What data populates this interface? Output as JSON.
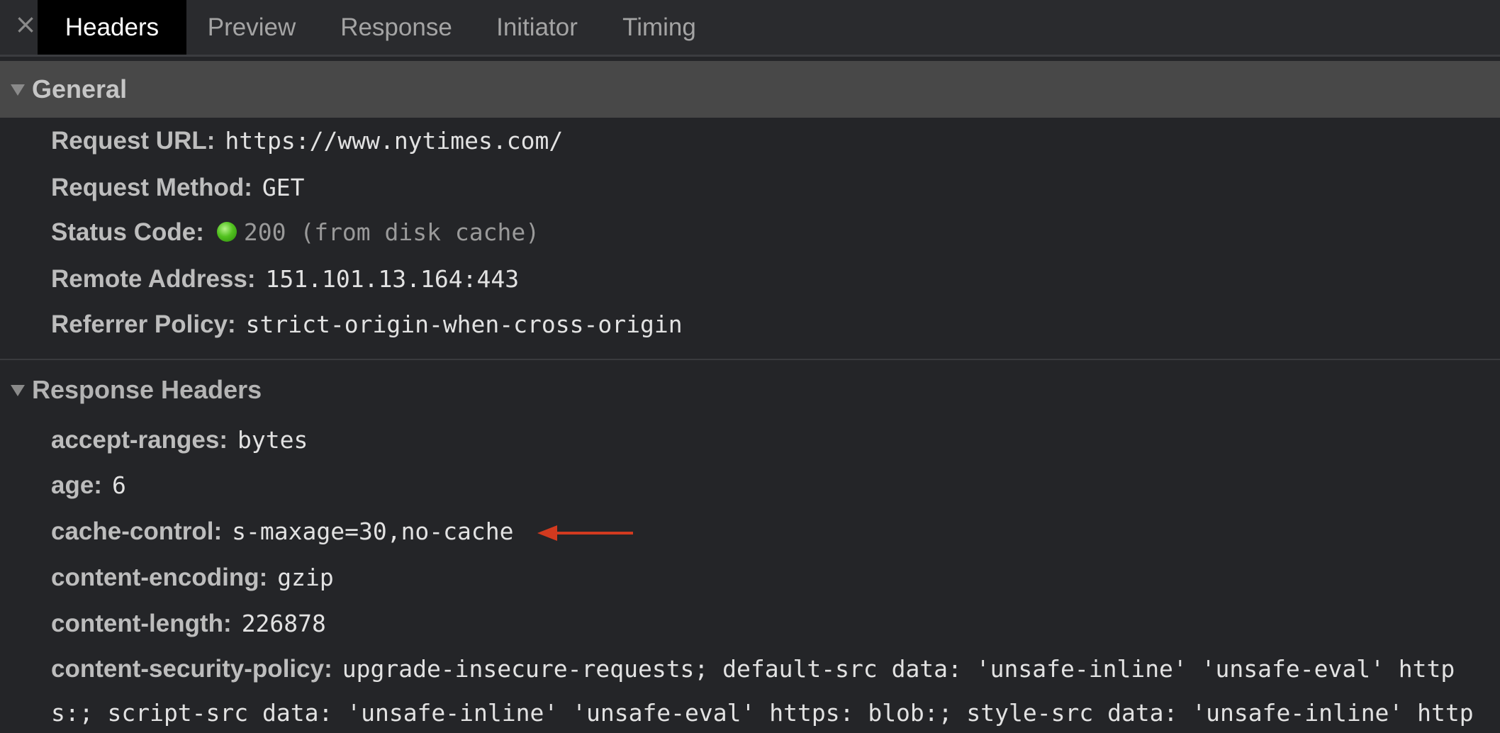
{
  "tabs": {
    "close_glyph": "×",
    "items": [
      "Headers",
      "Preview",
      "Response",
      "Initiator",
      "Timing"
    ]
  },
  "general": {
    "title": "General",
    "request_url_key": "Request URL:",
    "request_url_value": "https://www.nytimes.com/",
    "request_method_key": "Request Method:",
    "request_method_value": "GET",
    "status_code_key": "Status Code:",
    "status_code_value": "200  (from disk cache)",
    "remote_address_key": "Remote Address:",
    "remote_address_value": "151.101.13.164:443",
    "referrer_policy_key": "Referrer Policy:",
    "referrer_policy_value": "strict-origin-when-cross-origin"
  },
  "response_headers": {
    "title": "Response Headers",
    "rows": [
      {
        "key": "accept-ranges:",
        "value": "bytes"
      },
      {
        "key": "age:",
        "value": "6"
      },
      {
        "key": "cache-control:",
        "value": "s-maxage=30,no-cache"
      },
      {
        "key": "content-encoding:",
        "value": "gzip"
      },
      {
        "key": "content-length:",
        "value": "226878"
      },
      {
        "key": "content-security-policy:",
        "value": "upgrade-insecure-requests; default-src data: 'unsafe-inline' 'unsafe-eval' http"
      }
    ],
    "csp_continuation": "s:; script-src data: 'unsafe-inline' 'unsafe-eval' https: blob:; style-src data: 'unsafe-inline' http"
  },
  "colors": {
    "status_ok": "#52c21f",
    "annotation_arrow": "#d23a1f",
    "active_tab_bg": "#000000"
  }
}
